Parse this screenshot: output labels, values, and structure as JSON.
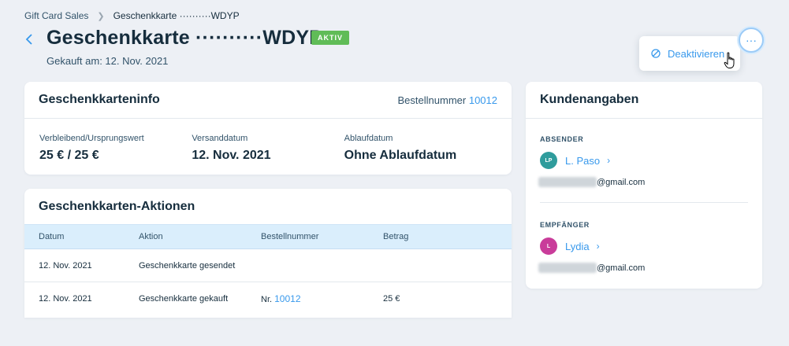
{
  "breadcrumb": {
    "parent": "Gift Card Sales",
    "current": "Geschenkkarte ··········WDYP"
  },
  "header": {
    "title": "Geschenkkarte ··········WDYP",
    "status": "AKTIV",
    "subtitle": "Gekauft am: 12. Nov. 2021"
  },
  "menu": {
    "more_label": "···",
    "deactivate_label": "Deaktivieren"
  },
  "info_card": {
    "title": "Geschenkkarteninfo",
    "order_label": "Bestellnummer",
    "order_number": "10012",
    "fields": [
      {
        "label": "Verbleibend/Ursprungswert",
        "value": "25 € / 25 €"
      },
      {
        "label": "Versanddatum",
        "value": "12. Nov. 2021"
      },
      {
        "label": "Ablaufdatum",
        "value": "Ohne Ablaufdatum"
      }
    ]
  },
  "actions_card": {
    "title": "Geschenkkarten-Aktionen",
    "columns": [
      "Datum",
      "Aktion",
      "Bestellnummer",
      "Betrag"
    ],
    "rows": [
      {
        "date": "12. Nov. 2021",
        "action": "Geschenkkarte gesendet",
        "order_prefix": "",
        "order_number": "",
        "amount": ""
      },
      {
        "date": "12. Nov. 2021",
        "action": "Geschenkkarte gekauft",
        "order_prefix": "Nr.",
        "order_number": "10012",
        "amount": "25 €"
      }
    ]
  },
  "customer_card": {
    "title": "Kundenangaben",
    "sender": {
      "label": "ABSENDER",
      "initials": "LP",
      "name": "L. Paso",
      "email_domain": "@gmail.com",
      "avatar_color": "#2f9c9c"
    },
    "recipient": {
      "label": "EMPFÄNGER",
      "initials": "L",
      "name": "Lydia",
      "email_domain": "@gmail.com",
      "avatar_color": "#c93c9a"
    }
  },
  "colors": {
    "accent": "#3899ec",
    "success": "#60bc57",
    "text": "#162d3d",
    "background": "#edf0f5"
  }
}
